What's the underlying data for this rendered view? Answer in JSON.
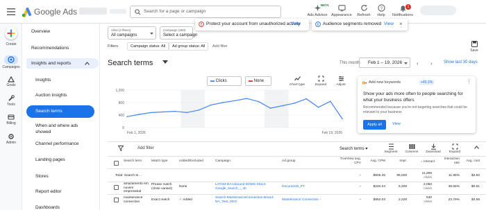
{
  "app": {
    "brand": "Google Ads"
  },
  "search": {
    "placeholder": "Search for a page or campaign"
  },
  "header_tools": [
    {
      "label": "Ads Advisor",
      "icon": "ads-advisor-icon"
    },
    {
      "label": "Appearance",
      "icon": "appearance-icon"
    },
    {
      "label": "Refresh",
      "icon": "refresh-icon"
    },
    {
      "label": "Help",
      "icon": "help-icon"
    },
    {
      "label": "Notifications",
      "icon": "bell-icon"
    }
  ],
  "beta_label": "BETA",
  "notifications_count": "1",
  "rail": [
    {
      "label": "Create",
      "icon": "plus-icon"
    },
    {
      "label": "Campaigns",
      "icon": "campaigns-icon"
    },
    {
      "label": "Goals",
      "icon": "goals-icon"
    },
    {
      "label": "Tools",
      "icon": "tools-icon"
    },
    {
      "label": "Billing",
      "icon": "billing-icon"
    },
    {
      "label": "Admin",
      "icon": "admin-icon"
    }
  ],
  "nav": {
    "overview": "Overview",
    "recommendations": "Recommendations",
    "insights_reports": "Insights and reports",
    "insights": "Insights",
    "auction_insights": "Auction insights",
    "search_terms": "Search terms",
    "when_where": "When and where ads showed",
    "channel_performance": "Channel performance",
    "landing_pages": "Landing pages",
    "stores": "Stores",
    "report_editor": "Report editor",
    "dashboards": "Dashboards"
  },
  "filters": {
    "view_label": "View (2 filters)",
    "view_value": "All campaigns",
    "campaign_label": "Campaign (363)",
    "campaign_value": "Select a campaign",
    "filters_label": "Filters",
    "chip_campaign_status": "Campaign status: All",
    "chip_adgroup_status": "Ad group status: All",
    "add_filter": "Add filter",
    "save_label": "Save"
  },
  "notifications": [
    {
      "text": "Protect your account from unauthorized activity",
      "action": "View",
      "icon": "error-icon",
      "color": "#d93025"
    },
    {
      "text": "Audience segments removed",
      "action": "View",
      "icon": "info-icon",
      "color": "#1a73e8"
    }
  ],
  "page": {
    "title": "Search terms",
    "date_label": "This month",
    "date_range": "Feb 1 – 19, 2026",
    "show_last": "Show last 30 days"
  },
  "chart_toolbar": {
    "metric1": "Clicks",
    "metric1_color": "#4285f4",
    "metric2": "None",
    "metric2_color": "#d93025",
    "tools": [
      {
        "label": "Chart type",
        "icon": "chart-type-icon"
      },
      {
        "label": "Expand",
        "icon": "expand-icon"
      },
      {
        "label": "Adjust",
        "icon": "adjust-icon"
      }
    ]
  },
  "chart_data": {
    "type": "line",
    "x_start_label": "Feb 1, 2026",
    "x_end_label": "Feb 19, 2026",
    "yticks": [
      "1,200",
      "800",
      "400",
      "0"
    ],
    "ylim": [
      0,
      1200
    ],
    "series": [
      {
        "color": "#4285f4",
        "x": [
          "Feb 1",
          "Feb 2",
          "Feb 3",
          "Feb 4",
          "Feb 5",
          "Feb 6",
          "Feb 7",
          "Feb 8",
          "Feb 9",
          "Feb 10",
          "Feb 11",
          "Feb 12",
          "Feb 13",
          "Feb 14",
          "Feb 15",
          "Feb 16",
          "Feb 17",
          "Feb 18",
          "Feb 19"
        ],
        "values": [
          350,
          420,
          480,
          500,
          520,
          480,
          560,
          720,
          800,
          860,
          930,
          830,
          620,
          700,
          780,
          920,
          650,
          840,
          280
        ]
      }
    ],
    "weekend_bands": [
      [
        5,
        6
      ],
      [
        12,
        13
      ]
    ],
    "grid": true
  },
  "recommendation": {
    "title": "Add new keywords",
    "badge": "+45.1%",
    "headline": "Show your ads more often to people searching for what your business offers",
    "description": "Recommended because you're not targeting searches that could be relevant to your business",
    "apply": "Apply all",
    "view": "View"
  },
  "table_toolbar": {
    "add_filter": "Add filter",
    "view_select": "Search terms",
    "tools": [
      {
        "label": "Segment",
        "icon": "segment-icon"
      },
      {
        "label": "Columns",
        "icon": "columns-icon"
      },
      {
        "label": "Download",
        "icon": "download-icon"
      },
      {
        "label": "Expand",
        "icon": "expand-icon"
      }
    ]
  },
  "table": {
    "headers": [
      "Search term",
      "Match type",
      "Added/Excluded",
      "Campaign",
      "Ad group",
      "TrueView avg. CPV",
      "Avg. CPM",
      "Impr.",
      "Interact",
      "Interaction rate",
      "Avg. cost"
    ],
    "total": {
      "label": "Total: Search te…",
      "cpv": "–",
      "cpm": "$505.45",
      "impr": "95,028",
      "interact_value": "11,265",
      "interact_unit": "clicks",
      "rate": "11.85%",
      "cost": "$2.82"
    },
    "rows": [
      {
        "term": "amazamento em nuvem empresarial",
        "match": "Phrase match (close variant)",
        "added": "None",
        "campaign": "LATAM-DA-Inbound-EDMS-SKU4-Google_search_-_nb",
        "adgroup": "Documents_PT",
        "cpv": "–",
        "cpm": "$240.24",
        "impr": "5,208",
        "interact_value": "2,060",
        "interact_unit": "clicks",
        "rate": "39.55%",
        "cost": "$0.61"
      },
      {
        "term": "maintenance connection",
        "match": "Exact match",
        "added": "Added",
        "campaign": "Search-MaintenanceConnection-Brand-NA_Test_SEO",
        "adgroup": "Maintenance Connection -",
        "cpv": "–",
        "cpm": "$852.03",
        "impr": "2,228",
        "interact_value": "530",
        "interact_unit": "clicks",
        "rate": "23.79%",
        "cost": "$3.58"
      }
    ]
  }
}
